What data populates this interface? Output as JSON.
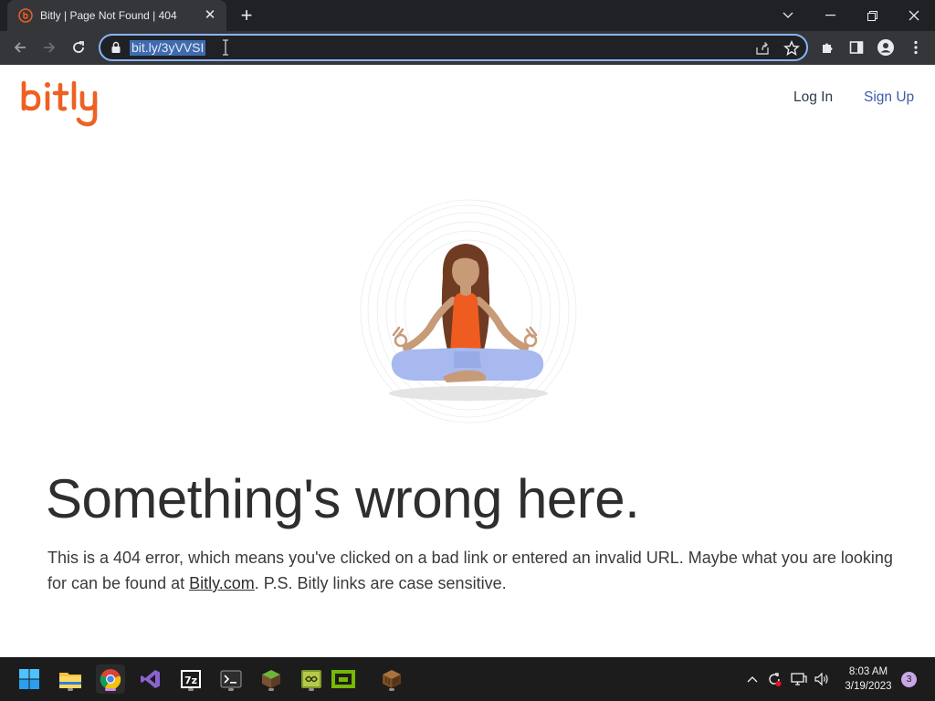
{
  "browser": {
    "tab": {
      "title": "Bitly | Page Not Found | 404",
      "favicon": "bitly-favicon-icon"
    },
    "new_tab_label": "+",
    "address_bar": {
      "url": "bit.ly/3yVVSI"
    },
    "accent_color": "#8ab4f8"
  },
  "page": {
    "logo_text": "bitly",
    "brand_color": "#ee6123",
    "nav": {
      "login": "Log In",
      "signup": "Sign Up"
    },
    "headline": "Something's wrong here.",
    "body_before_link": "This is a 404 error, which means you've clicked on a bad link or entered an invalid URL. Maybe what you are looking for can be found at ",
    "body_link": "Bitly.com",
    "body_after_link": ". P.S. Bitly links are case sensitive.",
    "illustration": "meditating-woman"
  },
  "taskbar": {
    "apps": [
      "start-icon",
      "file-explorer-icon",
      "chrome-icon",
      "visual-studio-icon",
      "7zip-icon",
      "terminal-icon",
      "minecraft-icon",
      "game-icon",
      "nvidia-icon",
      "crafting-table-icon"
    ],
    "time": "8:03 AM",
    "date": "3/19/2023",
    "notifications": "3"
  }
}
